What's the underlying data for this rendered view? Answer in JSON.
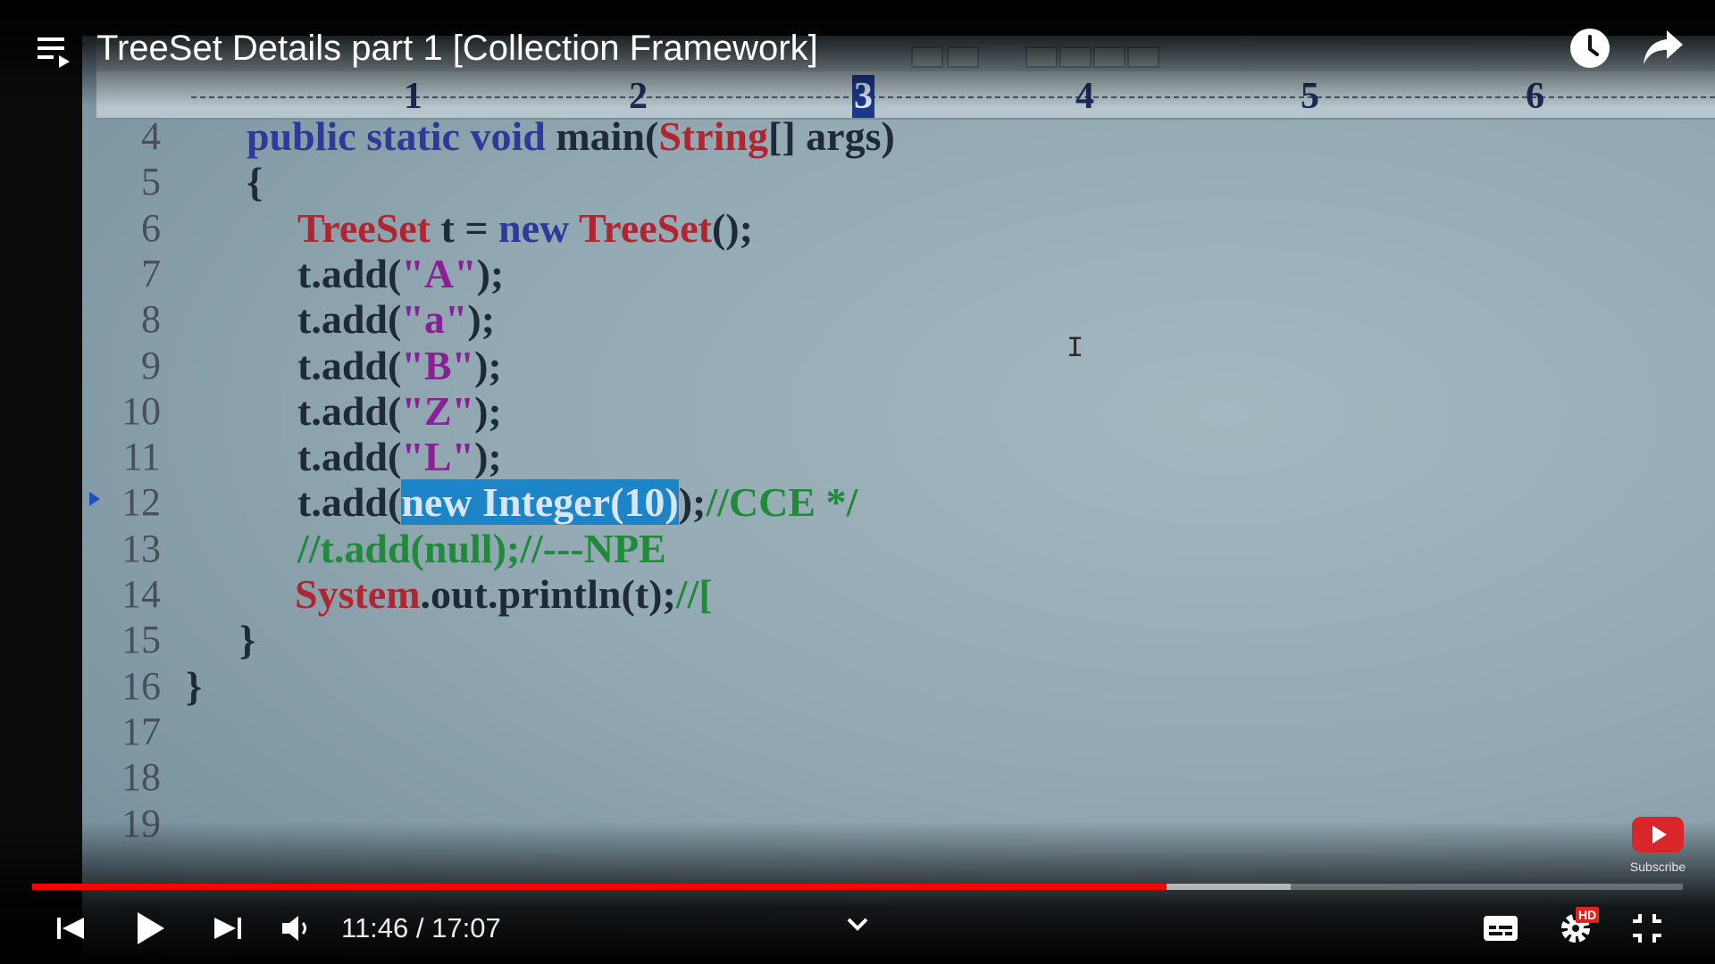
{
  "player": {
    "title": "TreeSet Details part 1 [Collection Framework]",
    "time_current": "11:46",
    "time_separator": " / ",
    "time_total": "17:07",
    "progress_played": 0.6874,
    "progress_buffered": 0.7622,
    "subscribe_label": "Subscribe",
    "hd_badge": "HD",
    "colors": {
      "progress": "#ff0000",
      "hd_badge": "#e62117"
    },
    "icons": [
      "playlist-icon",
      "watch-later-icon",
      "share-icon",
      "previous-icon",
      "play-icon",
      "next-icon",
      "volume-icon",
      "chevron-down-icon",
      "subtitles-icon",
      "settings-icon",
      "exit-fullscreen-icon",
      "subscribe-icon"
    ]
  },
  "editor": {
    "ruler_numbers": [
      "1",
      "2",
      "3",
      "4",
      "5",
      "6"
    ],
    "lines": [
      {
        "n": "4",
        "tokens": [
          [
            "public static void ",
            "kw"
          ],
          [
            "main(",
            "tx"
          ],
          [
            "String",
            "ty"
          ],
          [
            "[] args)",
            "tx"
          ]
        ]
      },
      {
        "n": "5",
        "tokens": [
          [
            "{",
            "tx"
          ]
        ]
      },
      {
        "n": "6",
        "tokens": [
          [
            "TreeSet",
            "ty"
          ],
          [
            " t = ",
            "tx"
          ],
          [
            "new ",
            "kw"
          ],
          [
            "TreeSet",
            "ty"
          ],
          [
            "();",
            "tx"
          ]
        ]
      },
      {
        "n": "7",
        "tokens": [
          [
            "t.add(",
            "tx"
          ],
          [
            "\"A\"",
            "str"
          ],
          [
            ");",
            "tx"
          ]
        ]
      },
      {
        "n": "8",
        "tokens": [
          [
            "t.add(",
            "tx"
          ],
          [
            "\"a\"",
            "str"
          ],
          [
            ");",
            "tx"
          ]
        ]
      },
      {
        "n": "9",
        "tokens": [
          [
            "t.add(",
            "tx"
          ],
          [
            "\"B\"",
            "str"
          ],
          [
            ");",
            "tx"
          ]
        ]
      },
      {
        "n": "10",
        "tokens": [
          [
            "t.add(",
            "tx"
          ],
          [
            "\"Z\"",
            "str"
          ],
          [
            ");",
            "tx"
          ]
        ]
      },
      {
        "n": "11",
        "tokens": [
          [
            "t.add(",
            "tx"
          ],
          [
            "\"L\"",
            "str"
          ],
          [
            ");",
            "tx"
          ]
        ]
      },
      {
        "n": "12",
        "tokens": [
          [
            "t.add(",
            "tx"
          ],
          [
            "new Integer(10)",
            "sel"
          ],
          [
            ");",
            "tx"
          ],
          [
            "//CCE */",
            "cm"
          ]
        ]
      },
      {
        "n": "13",
        "tokens": [
          [
            "//t.add(null);//---NPE",
            "cm"
          ]
        ]
      },
      {
        "n": "14",
        "tokens": [
          [
            "System",
            "ty"
          ],
          [
            ".out.println(t);",
            "tx"
          ],
          [
            "//[",
            "cm"
          ]
        ]
      },
      {
        "n": "15",
        "tokens": [
          [
            "}",
            "tx"
          ]
        ]
      },
      {
        "n": "16",
        "tokens": [
          [
            "}",
            "tx"
          ]
        ]
      },
      {
        "n": "17",
        "tokens": []
      },
      {
        "n": "18",
        "tokens": []
      },
      {
        "n": "19",
        "tokens": []
      }
    ]
  }
}
